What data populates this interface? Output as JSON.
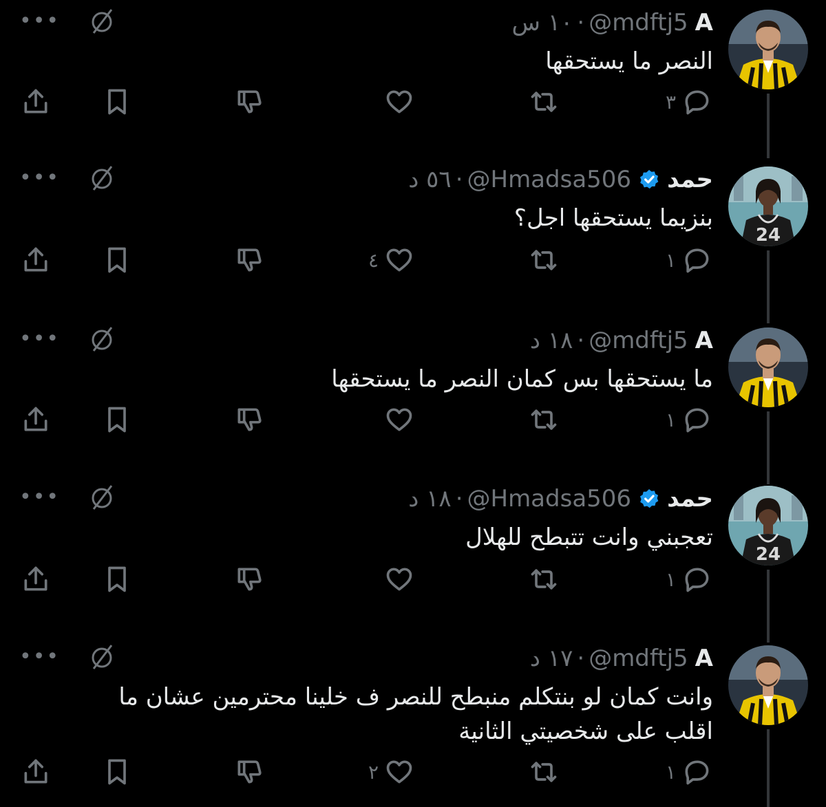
{
  "tweets": [
    {
      "author": "A",
      "verified": false,
      "handle": "@mdftj5",
      "dot": "·",
      "time": "١٠ س",
      "text": "النصر ما يستحقها",
      "replies": "٣",
      "retweets": "",
      "likes": "",
      "avatar": "player"
    },
    {
      "author": "حمد",
      "verified": true,
      "handle": "@Hmadsa506",
      "dot": "·",
      "time": "٥٦ د",
      "text": "بنزيما يستحقها اجل؟",
      "replies": "١",
      "retweets": "",
      "likes": "٤",
      "avatar": "fan"
    },
    {
      "author": "A",
      "verified": false,
      "handle": "@mdftj5",
      "dot": "·",
      "time": "١٨ د",
      "text": "ما يستحقها بس كمان النصر ما يستحقها",
      "replies": "١",
      "retweets": "",
      "likes": "",
      "avatar": "player"
    },
    {
      "author": "حمد",
      "verified": true,
      "handle": "@Hmadsa506",
      "dot": "·",
      "time": "١٨ د",
      "text": "تعجبني وانت تتبطح للهلال",
      "replies": "١",
      "retweets": "",
      "likes": "",
      "avatar": "fan"
    },
    {
      "author": "A",
      "verified": false,
      "handle": "@mdftj5",
      "dot": "·",
      "time": "١٧ د",
      "text": "وانت كمان لو بنتكلم منبطح للنصر ف خلينا محترمين عشان ما اقلب على شخصيتي الثانية",
      "replies": "١",
      "retweets": "",
      "likes": "٢",
      "avatar": "player"
    }
  ],
  "icons": {
    "more": "more-icon",
    "grok": "grok-icon",
    "reply": "reply-icon",
    "retweet": "retweet-icon",
    "like": "like-icon",
    "dislike": "dislike-icon",
    "bookmark": "bookmark-icon",
    "share": "share-icon",
    "verified": "verified-badge-icon"
  },
  "colors": {
    "background": "#000000",
    "text": "#e7e9ea",
    "muted": "#71767b",
    "verified": "#1d9bf0",
    "jersey_yellow": "#e8c400"
  }
}
